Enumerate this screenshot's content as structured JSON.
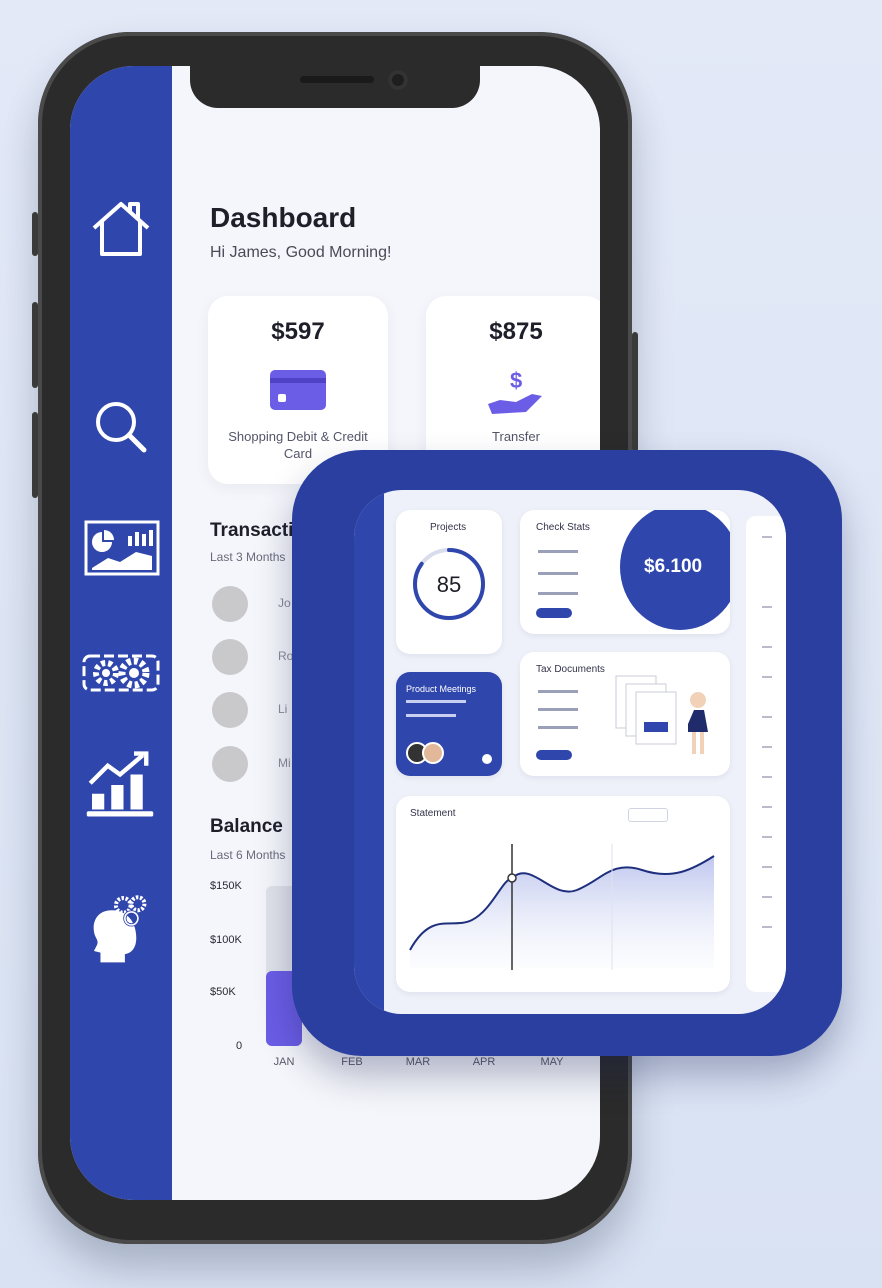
{
  "dashboard": {
    "title": "Dashboard",
    "greeting": "Hi James, Good Morning!"
  },
  "sidebar": {
    "items": [
      {
        "icon": "home-icon"
      },
      {
        "icon": "search-icon"
      },
      {
        "icon": "analytics-icon"
      },
      {
        "icon": "settings-icon"
      },
      {
        "icon": "growth-chart-icon"
      },
      {
        "icon": "ai-brain-icon"
      }
    ]
  },
  "cards": [
    {
      "amount": "$597",
      "label": "Shopping Debit & Credit Card",
      "icon": "credit-card-icon"
    },
    {
      "amount": "$875",
      "label": "Transfer",
      "icon": "money-hand-icon"
    }
  ],
  "transactions": {
    "title": "Transactions",
    "subtitle": "Last 3 Months",
    "items": [
      "Jo",
      "Ro",
      "Li",
      "Mi"
    ]
  },
  "balance": {
    "title": "Balance",
    "subtitle": "Last 6 Months",
    "y_ticks": [
      "$150K",
      "$100K",
      "$50K",
      "0"
    ],
    "x_ticks": [
      "JAN",
      "FEB",
      "MAR",
      "APR",
      "MAY"
    ]
  },
  "chart_data": {
    "type": "bar",
    "categories": [
      "JAN",
      "FEB",
      "MAR",
      "APR",
      "MAY"
    ],
    "values": [
      70,
      null,
      null,
      null,
      null
    ],
    "background_values": [
      150,
      null,
      null,
      null,
      null
    ],
    "ylim": [
      0,
      150
    ]
  },
  "overlay": {
    "progress": {
      "title": "Projects",
      "value": "85",
      "fraction": 0.85
    },
    "stats": {
      "title": "Check Stats",
      "amount": "$6.100"
    },
    "meetings": {
      "title": "Product Meetings"
    },
    "documents": {
      "title": "Tax Documents"
    },
    "line": {
      "title": "Statement"
    }
  },
  "colors": {
    "primary": "#2f46ac",
    "accent": "#6b5de6",
    "overlay": "#2a3f9f"
  }
}
